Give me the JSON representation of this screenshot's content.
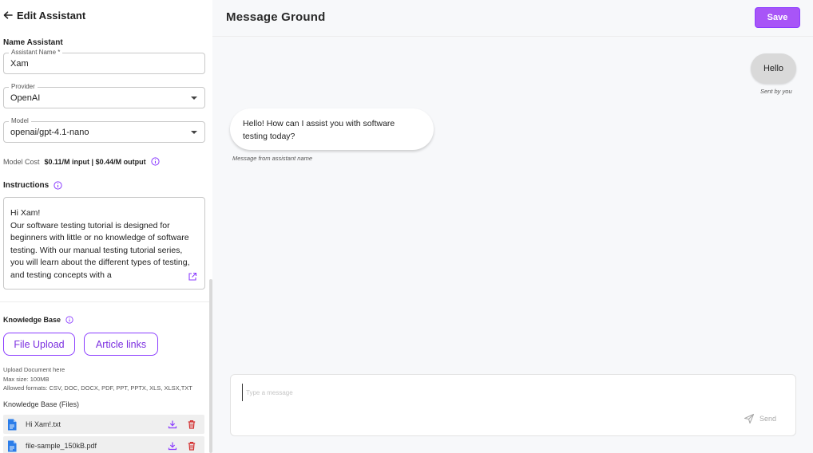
{
  "left": {
    "header_title": "Edit Assistant",
    "name_section": "Name Assistant",
    "assistant_name": {
      "label": "Assistant Name *",
      "value": "Xam"
    },
    "provider": {
      "label": "Provider",
      "value": "OpenAI"
    },
    "model": {
      "label": "Model",
      "value": "openai/gpt-4.1-nano"
    },
    "cost": {
      "label": "Model Cost",
      "value": "$0.11/M input | $0.44/M output"
    },
    "instructions_label": "Instructions",
    "instructions_text": "Hi Xam!\nOur software testing tutorial is designed for beginners with little or no knowledge of software testing. With our manual testing tutorial series, you will learn about the different types of testing, and testing concepts with a",
    "knowledge_base_label": "Knowledge Base",
    "file_upload_label": "File Upload",
    "article_links_label": "Article links",
    "upload_hint_1": "Upload Document here",
    "upload_hint_2": "Max size: 100MB",
    "upload_hint_3": "Allowed formats: CSV, DOC, DOCX, PDF, PPT, PPTX, XLS, XLSX,TXT",
    "files_title": "Knowledge Base (Files)",
    "files": [
      {
        "name": "Hi Xam!.txt"
      },
      {
        "name": "file-sample_150kB.pdf"
      }
    ]
  },
  "right": {
    "title": "Message Ground",
    "save_label": "Save",
    "user_message": "Hello",
    "sent_by": "Sent by you",
    "bot_message": "Hello! How can I assist you with software testing today?",
    "message_from": "Message from assistant name",
    "input_placeholder": "Type a message",
    "send_label": "Send"
  },
  "colors": {
    "accent": "#a855f7",
    "accent_text": "#7b2fe0",
    "delete": "#d32f2f"
  }
}
